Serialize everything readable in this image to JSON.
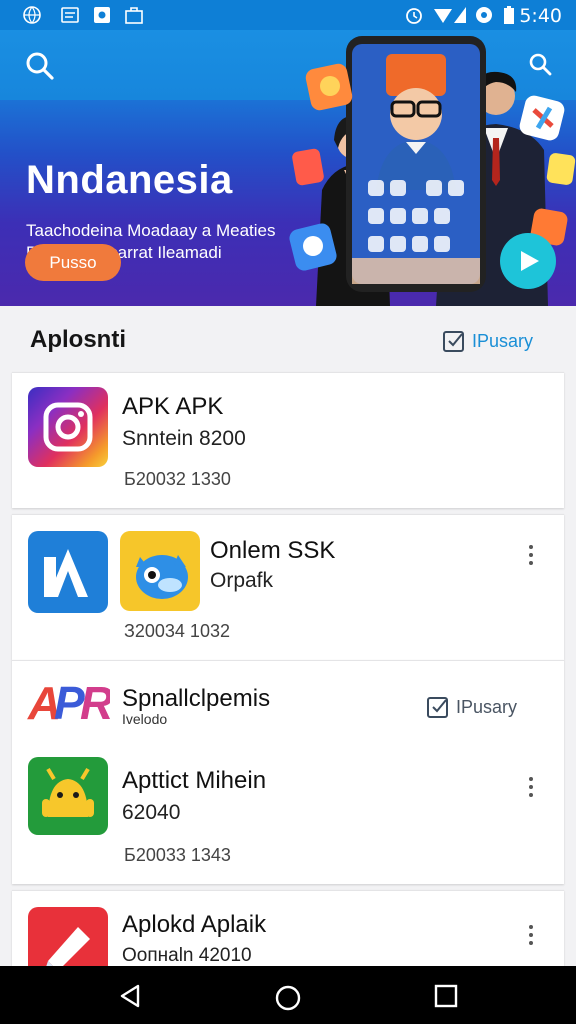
{
  "status_bar": {
    "time": "5:40"
  },
  "hero": {
    "title": "Nndanesia",
    "subtitle_line1": "Taachodeina Moadaay a Meaties",
    "subtitle_line2": "Pacodo  Bosarrat Ileamadi",
    "button_label": "Pusso"
  },
  "section": {
    "title": "Aplosnti",
    "action_label": "IPusary"
  },
  "apps": [
    {
      "title": "APK  APK",
      "subtitle": "Snntein  8200",
      "meta": "Б20032  1330"
    },
    {
      "title": "Onlem SSK",
      "subtitle": "Orpafk",
      "meta": "З20034  1032"
    },
    {
      "title": "Apttict  Mihein",
      "subtitle": "62040",
      "meta": "Б20033  1343"
    },
    {
      "title": "Aplokd Aplaik",
      "subtitle": "Оопнаln  42010"
    }
  ],
  "subsection": {
    "title": "Spnallclpemis",
    "caption": "Ivelodo",
    "action_label": "IPusary",
    "logo_text": "APR"
  },
  "colors": {
    "accent": "#1a8fd6",
    "hero_button": "#f07a3c",
    "play": "#1ec4d9",
    "hero_top": "#1a8fe2",
    "hero_bottom": "#4b29ad"
  }
}
